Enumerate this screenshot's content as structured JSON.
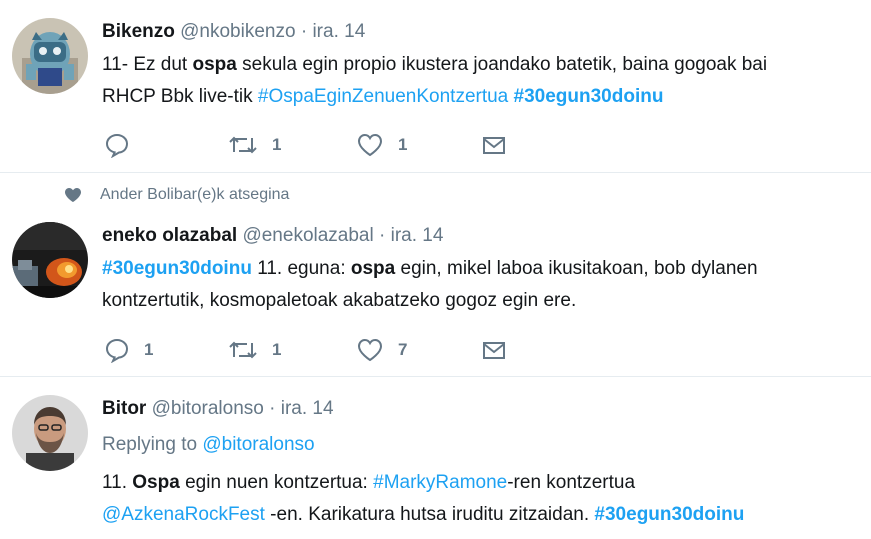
{
  "tweets": [
    {
      "name": "Bikenzo",
      "handle": "@nkobikenzo",
      "dot": "·",
      "date": "ira. 14",
      "line1": [
        "11- Ez dut ",
        "ospa",
        " sekula egin propio ikustera joandako batetik, baina gogoak bai"
      ],
      "line2": [
        "RHCP Bbk live-tik ",
        "#OspaEginZenuenKontzertua",
        " ",
        "#30egun30doinu"
      ],
      "replies": "",
      "retweets": "1",
      "likes": "1"
    },
    {
      "context": "Ander Bolibar(e)k atsegina",
      "name": "eneko olazabal",
      "handle": "@enekolazabal",
      "dot": "·",
      "date": "ira. 14",
      "line1": [
        "#30egun30doinu",
        " 11. eguna: ",
        "ospa",
        " egin, mikel laboa ikusitakoan, bob dylanen"
      ],
      "line2": "kontzertutik, kosmopaletoak akabatzeko gogoz egin ere.",
      "replies": "1",
      "retweets": "1",
      "likes": "7"
    },
    {
      "name": "Bitor",
      "handle": "@bitoralonso",
      "dot": "·",
      "date": "ira. 14",
      "reply_prefix": "Replying to ",
      "reply_to": "@bitoralonso",
      "line1": [
        "11. ",
        "Ospa",
        " egin nuen kontzertua: ",
        "#MarkyRamone",
        "-ren kontzertua"
      ],
      "line2": [
        "@AzkenaRockFest",
        " -en. Karikatura hutsa iruditu zitzaidan. ",
        "#30egun30doinu"
      ]
    }
  ],
  "icons": {
    "reply": "reply-icon",
    "retweet": "retweet-icon",
    "like": "heart-icon",
    "dm": "envelope-icon"
  },
  "colors": {
    "link": "#1da1f2",
    "muted": "#657786",
    "text": "#14171a",
    "divider": "#e6ecf0"
  }
}
